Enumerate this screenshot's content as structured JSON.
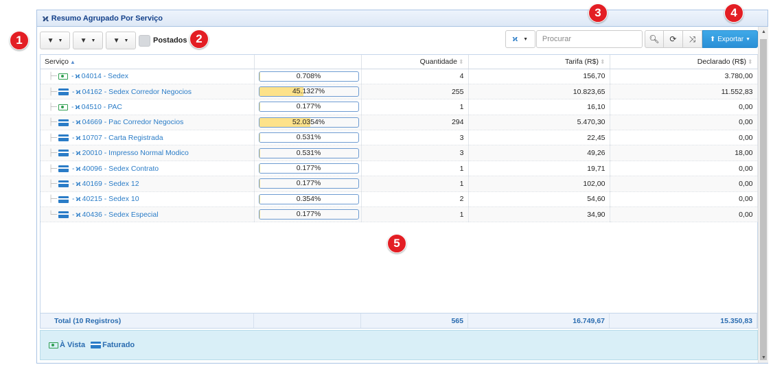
{
  "panel": {
    "title": "Resumo Agrupado Por Serviço"
  },
  "toolbar": {
    "postados_label": "Postados",
    "search_placeholder": "Procurar",
    "export_label": "Exportar"
  },
  "columns": {
    "servico": "Serviço",
    "quantidade": "Quantidade",
    "tarifa": "Tarifa (R$)",
    "declarado": "Declarado (R$)"
  },
  "rows": [
    {
      "pay": "cash",
      "code": "04014",
      "name": "Sedex",
      "label": "04014 - Sedex",
      "percent": 0.708,
      "percent_text": "0.708%",
      "quantidade": "4",
      "tarifa": "156,70",
      "declarado": "3.780,00"
    },
    {
      "pay": "card",
      "code": "04162",
      "name": "Sedex Corredor Negocios",
      "label": "04162 - Sedex Corredor Negocios",
      "percent": 45.1327,
      "percent_text": "45.1327%",
      "quantidade": "255",
      "tarifa": "10.823,65",
      "declarado": "11.552,83"
    },
    {
      "pay": "cash",
      "code": "04510",
      "name": "PAC",
      "label": "04510 - PAC",
      "percent": 0.177,
      "percent_text": "0.177%",
      "quantidade": "1",
      "tarifa": "16,10",
      "declarado": "0,00"
    },
    {
      "pay": "card",
      "code": "04669",
      "name": "Pac Corredor Negocios",
      "label": "04669 - Pac Corredor Negocios",
      "percent": 52.0354,
      "percent_text": "52.0354%",
      "quantidade": "294",
      "tarifa": "5.470,30",
      "declarado": "0,00"
    },
    {
      "pay": "card",
      "code": "10707",
      "name": "Carta Registrada",
      "label": "10707 - Carta Registrada",
      "percent": 0.531,
      "percent_text": "0.531%",
      "quantidade": "3",
      "tarifa": "22,45",
      "declarado": "0,00"
    },
    {
      "pay": "card",
      "code": "20010",
      "name": "Impresso Normal Modico",
      "label": "20010 - Impresso Normal Modico",
      "percent": 0.531,
      "percent_text": "0.531%",
      "quantidade": "3",
      "tarifa": "49,26",
      "declarado": "18,00"
    },
    {
      "pay": "card",
      "code": "40096",
      "name": "Sedex Contrato",
      "label": "40096 - Sedex Contrato",
      "percent": 0.177,
      "percent_text": "0.177%",
      "quantidade": "1",
      "tarifa": "19,71",
      "declarado": "0,00"
    },
    {
      "pay": "card",
      "code": "40169",
      "name": "Sedex 12",
      "label": "40169 - Sedex 12",
      "percent": 0.177,
      "percent_text": "0.177%",
      "quantidade": "1",
      "tarifa": "102,00",
      "declarado": "0,00"
    },
    {
      "pay": "card",
      "code": "40215",
      "name": "Sedex 10",
      "label": "40215 - Sedex 10",
      "percent": 0.354,
      "percent_text": "0.354%",
      "quantidade": "2",
      "tarifa": "54,60",
      "declarado": "0,00"
    },
    {
      "pay": "card",
      "code": "40436",
      "name": "Sedex Especial",
      "label": "40436 - Sedex Especial",
      "percent": 0.177,
      "percent_text": "0.177%",
      "quantidade": "1",
      "tarifa": "34,90",
      "declarado": "0,00"
    }
  ],
  "total": {
    "label": "Total (10 Registros)",
    "quantidade": "565",
    "tarifa": "16.749,67",
    "declarado": "15.350,83"
  },
  "legend": {
    "cash_label": "À Vista",
    "card_label": "Faturado"
  },
  "annotations": [
    "1",
    "2",
    "3",
    "4",
    "5"
  ],
  "colors": {
    "accent": "#2a7cc7",
    "cash": "#2e9e4f",
    "bar_fill": "#fde28a",
    "badge": "#e31e24"
  }
}
